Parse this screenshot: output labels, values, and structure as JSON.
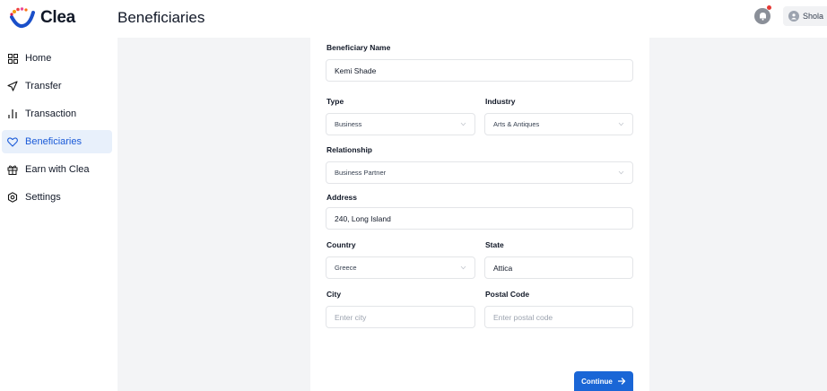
{
  "app": {
    "name": "Clea"
  },
  "header": {
    "title": "Beneficiaries",
    "user_name": "Shola"
  },
  "sidebar": {
    "items": [
      {
        "label": "Home",
        "icon": "grid-icon",
        "active": false
      },
      {
        "label": "Transfer",
        "icon": "send-icon",
        "active": false
      },
      {
        "label": "Transaction",
        "icon": "bar-chart-icon",
        "active": false
      },
      {
        "label": "Beneficiaries",
        "icon": "heart-icon",
        "active": true
      },
      {
        "label": "Earn with Clea",
        "icon": "gift-icon",
        "active": false
      },
      {
        "label": "Settings",
        "icon": "gear-icon",
        "active": false
      }
    ]
  },
  "form": {
    "beneficiary_name": {
      "label": "Beneficiary Name",
      "value": "Kemi Shade"
    },
    "type": {
      "label": "Type",
      "value": "Business"
    },
    "industry": {
      "label": "Industry",
      "value": "Arts & Antiques"
    },
    "relationship": {
      "label": "Relationship",
      "value": "Business Partner"
    },
    "address": {
      "label": "Address",
      "value": "240, Long Island"
    },
    "country": {
      "label": "Country",
      "value": "Greece"
    },
    "state": {
      "label": "State",
      "value": "Attica"
    },
    "city": {
      "label": "City",
      "placeholder": "Enter city",
      "value": ""
    },
    "postal_code": {
      "label": "Postal Code",
      "placeholder": "Enter postal code",
      "value": ""
    },
    "continue_label": "Continue",
    "continue_icon": "arrow-right-icon"
  },
  "colors": {
    "accent": "#1a66d6",
    "active_bg": "#e8f0fb",
    "notification_dot": "#e53935"
  }
}
